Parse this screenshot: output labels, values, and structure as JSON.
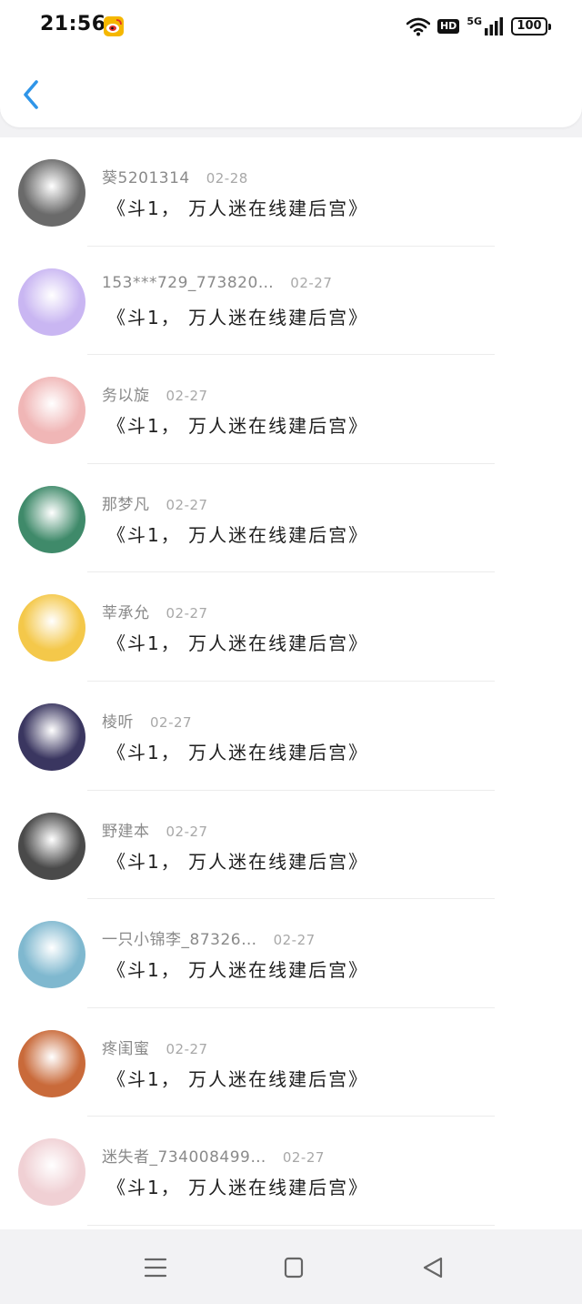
{
  "status_bar": {
    "time": "21:56",
    "app_icon": "weibo-icon",
    "wifi_icon": "wifi-icon",
    "hd_label": "HD",
    "network_label": "5G",
    "signal_icon": "signal-icon",
    "battery": "100"
  },
  "header": {
    "back_icon": "chevron-left-icon",
    "accent_color": "#2f95e8"
  },
  "messages": [
    {
      "name": "葵5201314",
      "date": "02-28",
      "text": "《斗1， 万人迷在线建后宫》",
      "avatar_color": "#6a6a6a"
    },
    {
      "name": "153***729_773820…",
      "date": "02-27",
      "text": "《斗1， 万人迷在线建后宫》",
      "avatar_color": "#c9b6f2"
    },
    {
      "name": "务以旋",
      "date": "02-27",
      "text": "《斗1， 万人迷在线建后宫》",
      "avatar_color": "#f0b6b6"
    },
    {
      "name": "那梦凡",
      "date": "02-27",
      "text": "《斗1， 万人迷在线建后宫》",
      "avatar_color": "#3f8a6a"
    },
    {
      "name": "莘承允",
      "date": "02-27",
      "text": "《斗1， 万人迷在线建后宫》",
      "avatar_color": "#f4c84a"
    },
    {
      "name": "棱听",
      "date": "02-27",
      "text": "《斗1， 万人迷在线建后宫》",
      "avatar_color": "#3a3660"
    },
    {
      "name": "野建本",
      "date": "02-27",
      "text": "《斗1， 万人迷在线建后宫》",
      "avatar_color": "#4a4a4a"
    },
    {
      "name": "一只小锦李_87326…",
      "date": "02-27",
      "text": "《斗1， 万人迷在线建后宫》",
      "avatar_color": "#7fb8cf"
    },
    {
      "name": "疼闺蜜",
      "date": "02-27",
      "text": "《斗1， 万人迷在线建后宫》",
      "avatar_color": "#c96a3a"
    },
    {
      "name": "迷失者_734008499…",
      "date": "02-27",
      "text": "《斗1， 万人迷在线建后宫》",
      "avatar_color": "#f0d0d4"
    }
  ],
  "nav_bar": {
    "menu_icon": "menu-icon",
    "home_icon": "home-square-icon",
    "back_icon": "triangle-back-icon"
  }
}
